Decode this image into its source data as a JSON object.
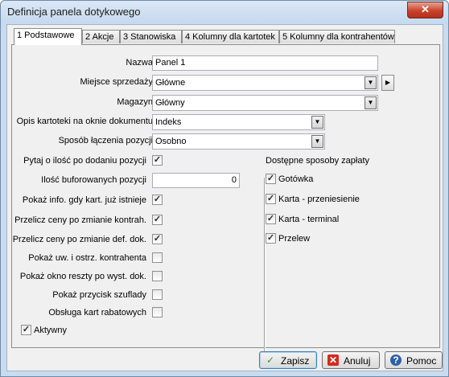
{
  "window": {
    "title": "Definicja panela dotykowego",
    "close_label": "✕"
  },
  "tabs": [
    {
      "label": "1 Podstawowe",
      "active": true
    },
    {
      "label": "2 Akcje"
    },
    {
      "label": "3 Stanowiska"
    },
    {
      "label": "4 Kolumny dla kartotek"
    },
    {
      "label": "5 Kolumny dla kontrahentów"
    }
  ],
  "form": {
    "nazwa": {
      "label": "Nazwa",
      "value": "Panel 1"
    },
    "miejsce": {
      "label": "Miejsce sprzedaży",
      "value": "Główne"
    },
    "magazyn": {
      "label": "Magazyn",
      "value": "Główny"
    },
    "opis": {
      "label": "Opis kartoteki na oknie dokumentu",
      "value": "Indeks"
    },
    "sposob": {
      "label": "Sposób łączenia pozycji",
      "value": "Osobno"
    },
    "ilosc_buf": {
      "label": "Ilość buforowanych pozycji",
      "value": "0"
    }
  },
  "options": [
    {
      "label": "Pytaj o ilość po dodaniu pozycji",
      "checked": true
    },
    {
      "label": "Pokaż info. gdy kart. już istnieje",
      "checked": true
    },
    {
      "label": "Przelicz ceny po zmianie kontrah.",
      "checked": true
    },
    {
      "label": "Przelicz ceny po zmianie def. dok.",
      "checked": true
    },
    {
      "label": "Pokaż uw. i ostrz. kontrahenta",
      "checked": false
    },
    {
      "label": "Pokaż okno reszty po wyst. dok.",
      "checked": false
    },
    {
      "label": "Pokaż przycisk szuflady",
      "checked": false
    },
    {
      "label": "Obsługa kart rabatowych",
      "checked": false
    }
  ],
  "aktywny": {
    "label": "Aktywny",
    "checked": true
  },
  "payments": {
    "title": "Dostępne sposoby zapłaty",
    "items": [
      {
        "label": "Gotówka",
        "checked": true
      },
      {
        "label": "Karta - przeniesienie",
        "checked": true
      },
      {
        "label": "Karta - terminal",
        "checked": true
      },
      {
        "label": "Przelew",
        "checked": true
      }
    ]
  },
  "buttons": {
    "save": {
      "label": "Zapisz",
      "icon": "check-icon",
      "color": "#3a9a2a"
    },
    "cancel": {
      "label": "Anuluj",
      "icon": "x-icon",
      "color": "#d22b1e"
    },
    "help": {
      "label": "Pomoc",
      "icon": "help-icon",
      "color": "#2d5fa8"
    }
  },
  "glyphs": {
    "check": "✓",
    "arrow_down": "▼",
    "arrow_right": "▶"
  }
}
